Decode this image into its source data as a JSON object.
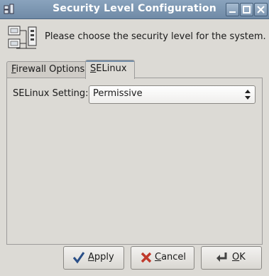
{
  "window": {
    "title": "Security Level Configuration"
  },
  "header": {
    "text": "Please choose the security level for the system.",
    "icon": "security-level-icon"
  },
  "tabs": [
    {
      "label": "Firewall Options",
      "mnemonic": "F",
      "rest": "irewall Options",
      "active": false
    },
    {
      "label": "SELinux",
      "mnemonic": "S",
      "rest": "ELinux",
      "active": true
    }
  ],
  "selinux": {
    "label": "SELinux Setting:",
    "value": "Permissive"
  },
  "buttons": {
    "apply": {
      "label": "Apply",
      "mnemonic": "A",
      "rest": "pply",
      "icon": "checkmark-icon"
    },
    "cancel": {
      "label": "Cancel",
      "mnemonic": "C",
      "rest": "ancel",
      "icon": "x-icon"
    },
    "ok": {
      "label": "OK",
      "mnemonic": "O",
      "rest": "K",
      "icon": "enter-icon"
    }
  },
  "colors": {
    "titlebar": "#7f99b4",
    "background": "#dcdad5",
    "cancel_x": "#c0392b",
    "apply_check": "#2a4f88"
  }
}
